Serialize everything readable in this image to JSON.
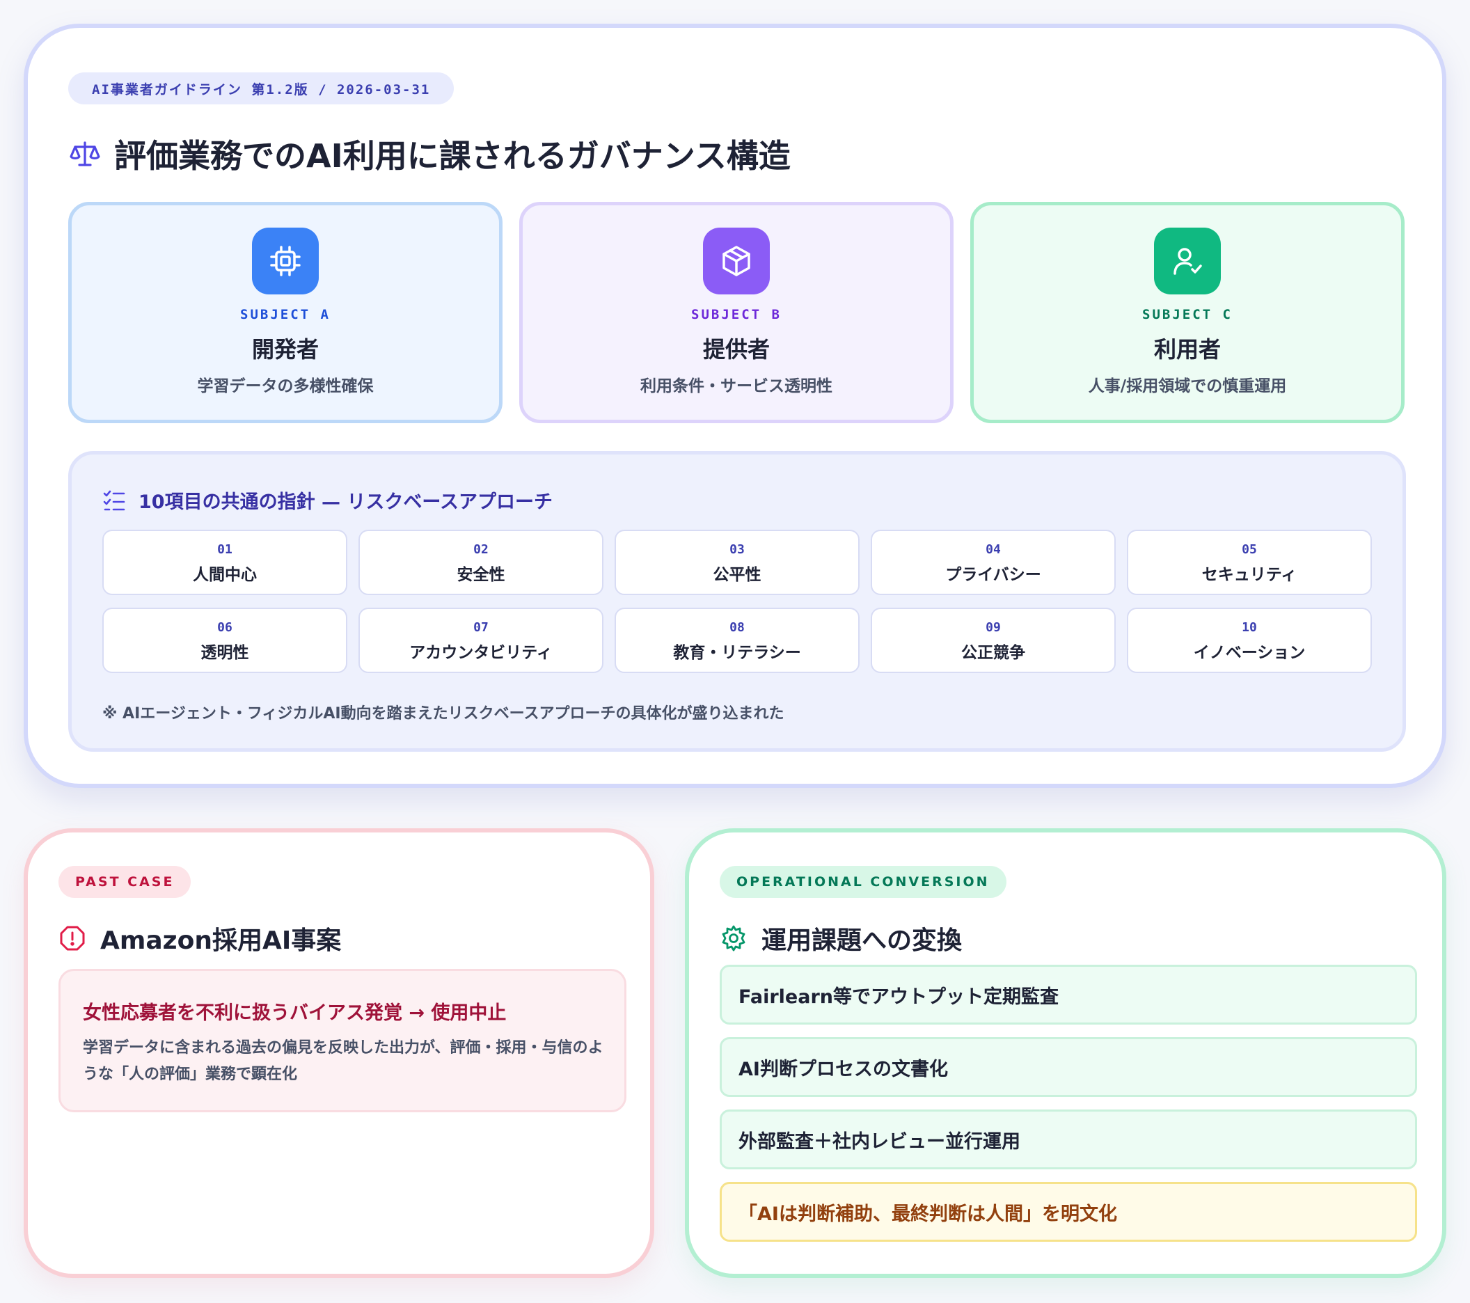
{
  "header": {
    "doc_badge": "AI事業者ガイドライン 第1.2版 / 2026-03-31",
    "title": "評価業務でのAI利用に課されるガバナンス構造"
  },
  "subjects": [
    {
      "tag": "SUBJECT A",
      "name": "開発者",
      "desc": "学習データの多様性確保",
      "icon": "chip-icon",
      "color": "#3b82f6"
    },
    {
      "tag": "SUBJECT B",
      "name": "提供者",
      "desc": "利用条件・サービス透明性",
      "icon": "package-icon",
      "color": "#8b5cf6"
    },
    {
      "tag": "SUBJECT C",
      "name": "利用者",
      "desc": "人事/採用領域での慎重運用",
      "icon": "user-check-icon",
      "color": "#10b981"
    }
  ],
  "principles": {
    "heading": "10項目の共通の指針 — リスクベースアプローチ",
    "items": [
      {
        "num": "01",
        "label": "人間中心"
      },
      {
        "num": "02",
        "label": "安全性"
      },
      {
        "num": "03",
        "label": "公平性"
      },
      {
        "num": "04",
        "label": "プライバシー"
      },
      {
        "num": "05",
        "label": "セキュリティ"
      },
      {
        "num": "06",
        "label": "透明性"
      },
      {
        "num": "07",
        "label": "アカウンタビリティ"
      },
      {
        "num": "08",
        "label": "教育・リテラシー"
      },
      {
        "num": "09",
        "label": "公正競争"
      },
      {
        "num": "10",
        "label": "イノベーション"
      }
    ],
    "note": "※ AIエージェント・フィジカルAI動向を踏まえたリスクベースアプローチの具体化が盛り込まれた"
  },
  "past_case": {
    "pill": "PAST CASE",
    "title": "Amazon採用AI事案",
    "headline": "女性応募者を不利に扱うバイアス発覚 → 使用中止",
    "body": "学習データに含まれる過去の偏見を反映した出力が、評価・採用・与信のような「人の評価」業務で顕在化"
  },
  "operations": {
    "pill": "OPERATIONAL CONVERSION",
    "title": "運用課題への変換",
    "items": [
      "Fairlearn等でアウトプット定期監査",
      "AI判断プロセスの文書化",
      "外部監査＋社内レビュー並行運用",
      "「AIは判断補助、最終判断は人間」を明文化"
    ]
  },
  "colors": {
    "accent": "#3b3fb0",
    "danger": "#be123c",
    "success": "#047857",
    "warning": "#92400e"
  }
}
